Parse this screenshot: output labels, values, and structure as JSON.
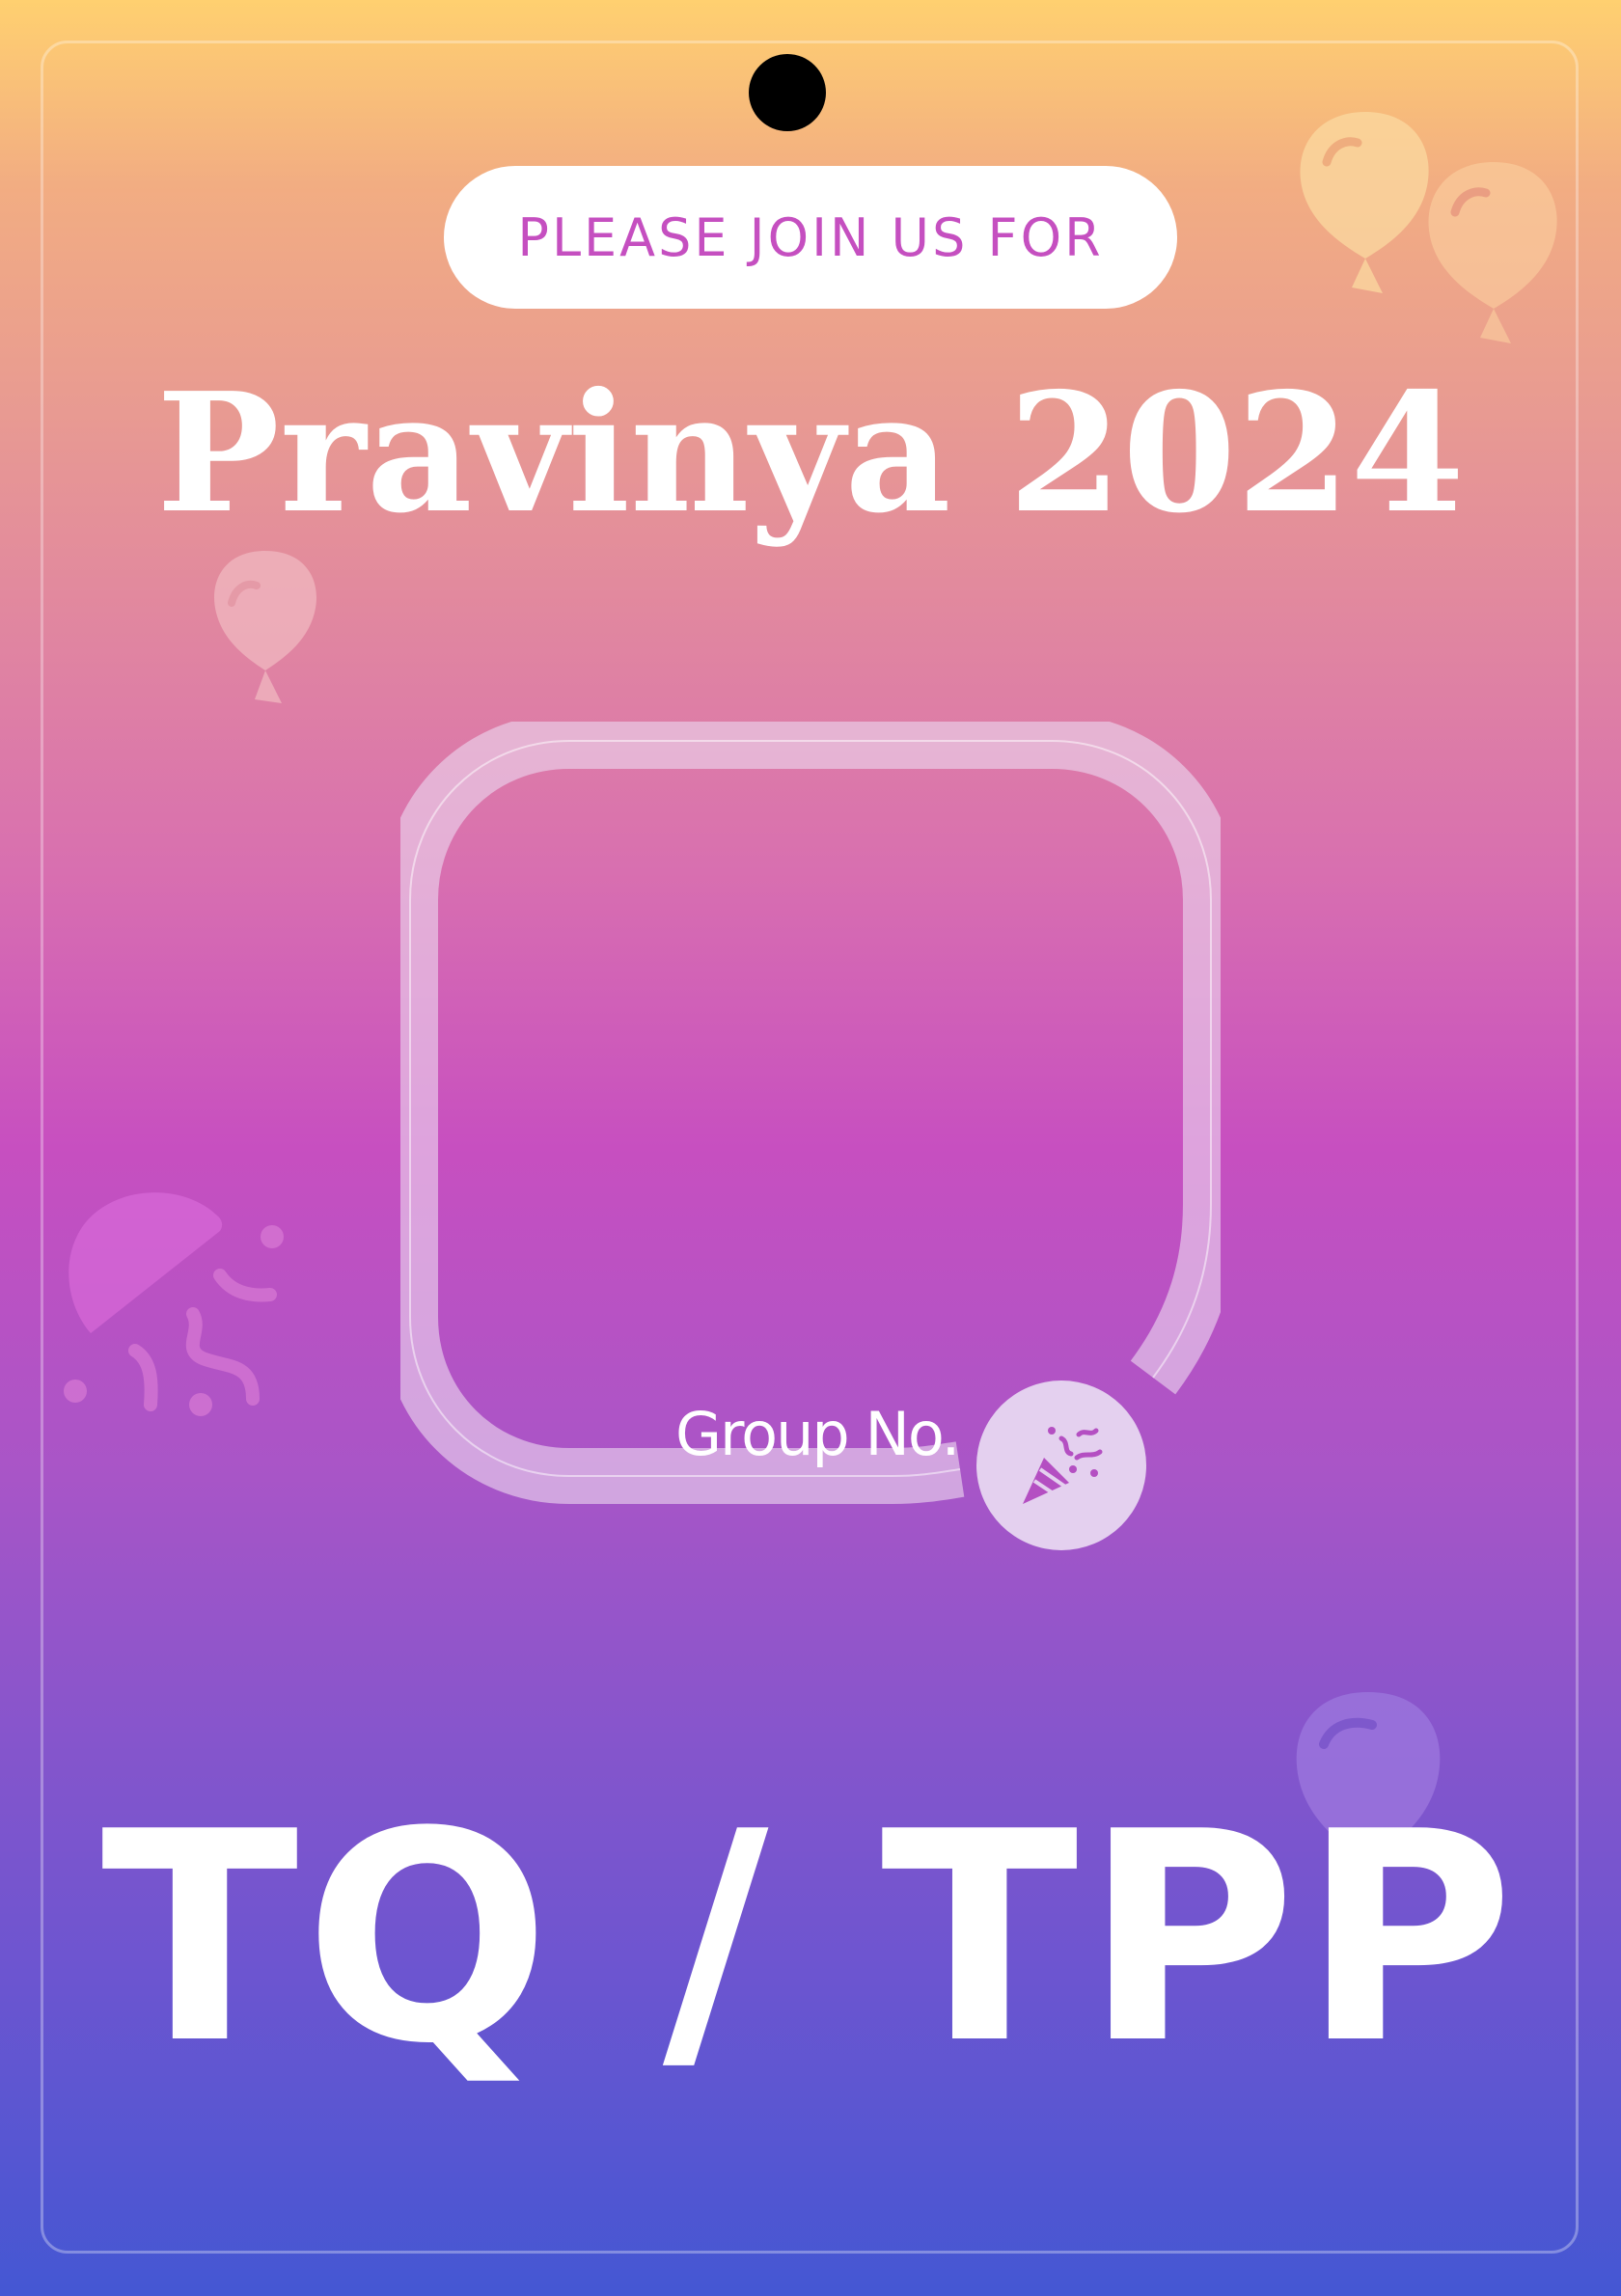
{
  "invite": {
    "text": "PLEASE JOIN US FOR"
  },
  "event": {
    "title": "Pravinya 2024"
  },
  "photo_frame": {
    "group_label": "Group No."
  },
  "group_code": "TQ / TPP",
  "icons": {
    "party": "party-popper-icon",
    "balloon": "balloon-icon",
    "confetti": "confetti-icon"
  },
  "colors": {
    "accent_text": "#c54fc0",
    "title": "#ffffff",
    "gradient_top": "#ffd070",
    "gradient_mid": "#c74fc0",
    "gradient_bottom": "#4457d3"
  }
}
